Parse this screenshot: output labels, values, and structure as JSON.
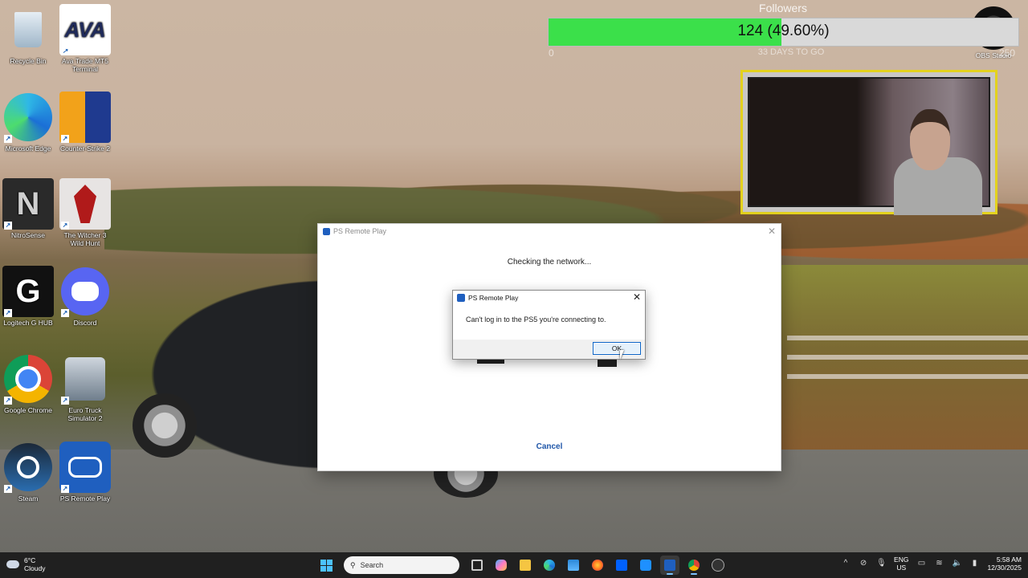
{
  "desktop": {
    "icons": [
      {
        "label": "Recycle Bin"
      },
      {
        "label": "Ava Trade MT5 Terminal",
        "glyph": "AVA"
      },
      {
        "label": "Microsoft Edge"
      },
      {
        "label": "Counter-Strike 2"
      },
      {
        "label": "NitroSense",
        "glyph": "N"
      },
      {
        "label": "The Witcher 3 Wild Hunt"
      },
      {
        "label": "Logitech G HUB",
        "glyph": "G"
      },
      {
        "label": "Discord"
      },
      {
        "label": "Google Chrome"
      },
      {
        "label": "Euro Truck Simulator 2"
      },
      {
        "label": "Steam"
      },
      {
        "label": "PS Remote Play"
      }
    ],
    "obs_icon": {
      "label": "OBS Studio"
    }
  },
  "overlay": {
    "title": "Followers",
    "value_text": "124 (49.60%)",
    "progress_fraction": 0.496,
    "min": "0",
    "max": "250",
    "subtitle": "33 DAYS TO GO",
    "colors": {
      "fill": "#3be04a",
      "track": "#d9d9d9",
      "webcam_border": "#e3d21e"
    }
  },
  "ps_window": {
    "title": "PS Remote Play",
    "status": "Checking the network...",
    "cancel_label": "Cancel"
  },
  "dialog": {
    "title": "PS Remote Play",
    "message": "Can't log in to the PS5 you're connecting to.",
    "ok_label": "OK"
  },
  "taskbar": {
    "weather_temp": "6°C",
    "weather_desc": "Cloudy",
    "search_placeholder": "Search",
    "lang_line1": "ENG",
    "lang_line2": "US",
    "time": "5:58 AM",
    "date": "12/30/2025"
  }
}
